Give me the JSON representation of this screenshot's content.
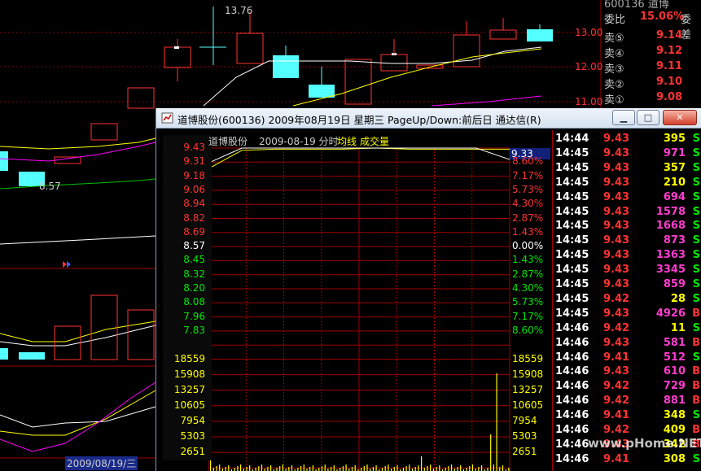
{
  "background_chart": {
    "high_label": "13.76",
    "low_label": "8.57",
    "date_cursor": "2009/08/19/三",
    "y_ticks": [
      "13.00",
      "12.00",
      "11.00"
    ],
    "header_partial": "600136  道博"
  },
  "order_book": {
    "ratio_label": "委比",
    "ratio_value": "15.06%",
    "diff_label": "委差",
    "asks": [
      {
        "label": "卖⑤",
        "price": "9.14"
      },
      {
        "label": "卖④",
        "price": "9.12"
      },
      {
        "label": "卖③",
        "price": "9.11"
      },
      {
        "label": "卖②",
        "price": "9.10"
      },
      {
        "label": "卖①",
        "price": "9.08"
      }
    ]
  },
  "window": {
    "title": "道博股份(600136) 2009年08月19日 星期三 PageUp/Down:前后日 通达信(R)",
    "minimize": "▁",
    "maximize": "□",
    "close": "✕"
  },
  "chart": {
    "stock": "道博股份",
    "date_label": "2009-08-19 分时",
    "avg_label": "均线",
    "vol_label": "成交量",
    "current_price": "9.33",
    "prev_close": "8.57",
    "price_ticks": [
      "9.43",
      "9.31",
      "9.18",
      "9.06",
      "8.94",
      "8.82",
      "8.69",
      "8.57",
      "8.45",
      "8.32",
      "8.20",
      "8.08",
      "7.96",
      "7.83"
    ],
    "pct_ticks": [
      "10.04%",
      "8.60%",
      "7.17%",
      "5.73%",
      "4.30%",
      "2.87%",
      "1.43%",
      "0.00%",
      "1.43%",
      "2.87%",
      "4.30%",
      "5.73%",
      "7.17%",
      "8.60%"
    ],
    "volume_ticks": [
      "18559",
      "15908",
      "13257",
      "10605",
      "7954",
      "5303",
      "2651"
    ]
  },
  "chart_data": {
    "type": "line",
    "title": "道博股份 2009-08-19 分时",
    "series": [
      {
        "name": "均线",
        "values": [
          9.25,
          9.41,
          9.42,
          9.42,
          9.42,
          9.43,
          9.42,
          9.42,
          9.42,
          9.42
        ]
      },
      {
        "name": "price",
        "values": [
          9.3,
          9.43,
          9.43,
          9.43,
          9.43,
          9.43,
          9.43,
          9.43,
          9.43,
          9.33
        ]
      }
    ],
    "ylim": [
      7.83,
      9.43
    ]
  },
  "trades": [
    {
      "time": "14:44",
      "price": "9.43",
      "vol": "395",
      "side": "S"
    },
    {
      "time": "14:45",
      "price": "9.43",
      "vol": "971",
      "side": "S"
    },
    {
      "time": "14:45",
      "price": "9.43",
      "vol": "357",
      "side": "S"
    },
    {
      "time": "14:45",
      "price": "9.43",
      "vol": "210",
      "side": "S"
    },
    {
      "time": "14:45",
      "price": "9.43",
      "vol": "694",
      "side": "S"
    },
    {
      "time": "14:45",
      "price": "9.43",
      "vol": "1578",
      "side": "S"
    },
    {
      "time": "14:45",
      "price": "9.43",
      "vol": "1668",
      "side": "S"
    },
    {
      "time": "14:45",
      "price": "9.43",
      "vol": "873",
      "side": "S"
    },
    {
      "time": "14:45",
      "price": "9.43",
      "vol": "1363",
      "side": "S"
    },
    {
      "time": "14:45",
      "price": "9.43",
      "vol": "3345",
      "side": "S"
    },
    {
      "time": "14:45",
      "price": "9.43",
      "vol": "859",
      "side": "S"
    },
    {
      "time": "14:45",
      "price": "9.42",
      "vol": "28",
      "side": "S"
    },
    {
      "time": "14:45",
      "price": "9.43",
      "vol": "4926",
      "side": "B"
    },
    {
      "time": "14:46",
      "price": "9.42",
      "vol": "11",
      "side": "S"
    },
    {
      "time": "14:46",
      "price": "9.43",
      "vol": "581",
      "side": "B"
    },
    {
      "time": "14:46",
      "price": "9.41",
      "vol": "512",
      "side": "S"
    },
    {
      "time": "14:46",
      "price": "9.43",
      "vol": "610",
      "side": "B"
    },
    {
      "time": "14:46",
      "price": "9.42",
      "vol": "729",
      "side": "B"
    },
    {
      "time": "14:46",
      "price": "9.42",
      "vol": "881",
      "side": "B"
    },
    {
      "time": "14:46",
      "price": "9.41",
      "vol": "348",
      "side": "S"
    },
    {
      "time": "14:46",
      "price": "9.42",
      "vol": "409",
      "side": "B"
    },
    {
      "time": "14:46",
      "price": "9.43",
      "vol": "342",
      "side": "B"
    },
    {
      "time": "14:46",
      "price": "9.41",
      "vol": "308",
      "side": "S"
    }
  ],
  "watermark": "www.pHome.NET",
  "colors": {
    "up": "#ff3232",
    "down": "#00e600",
    "avg": "#ffff00",
    "cyan": "#54ffff",
    "grid": "#a00000"
  }
}
